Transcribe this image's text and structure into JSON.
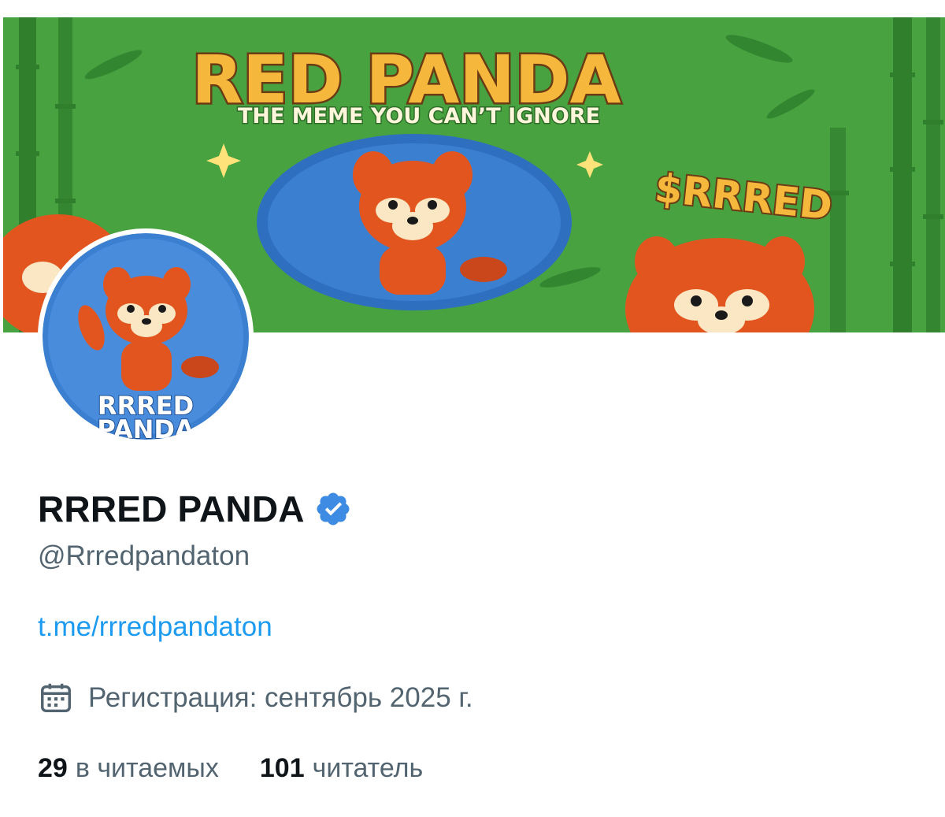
{
  "banner": {
    "title": "RED PANDA",
    "subtitle": "THE MEME YOU CAN’T IGNORE",
    "ticker": "$RRRED",
    "colors": {
      "background": "#3f9a3b",
      "title_fill": "#f6b83c",
      "coin": "#3b7fd1",
      "panda": "#e2551f"
    }
  },
  "avatar": {
    "line1": "RRRED",
    "line2": "PANDA",
    "background": "#3b7fd1"
  },
  "profile": {
    "name": "RRRED PANDA",
    "verified_icon": "verified-badge-icon",
    "handle": "@Rrredpandaton",
    "link": "t.me/rrredpandaton",
    "joined_icon": "calendar-icon",
    "joined": "Регистрация: сентябрь 2025 г."
  },
  "stats": {
    "following_count": "29",
    "following_label": "в читаемых",
    "followers_count": "101",
    "followers_label": "читатель"
  },
  "colors": {
    "accent": "#1d9bf0",
    "text_primary": "#0f1419",
    "text_secondary": "#536471",
    "verified": "#3e8be4"
  }
}
